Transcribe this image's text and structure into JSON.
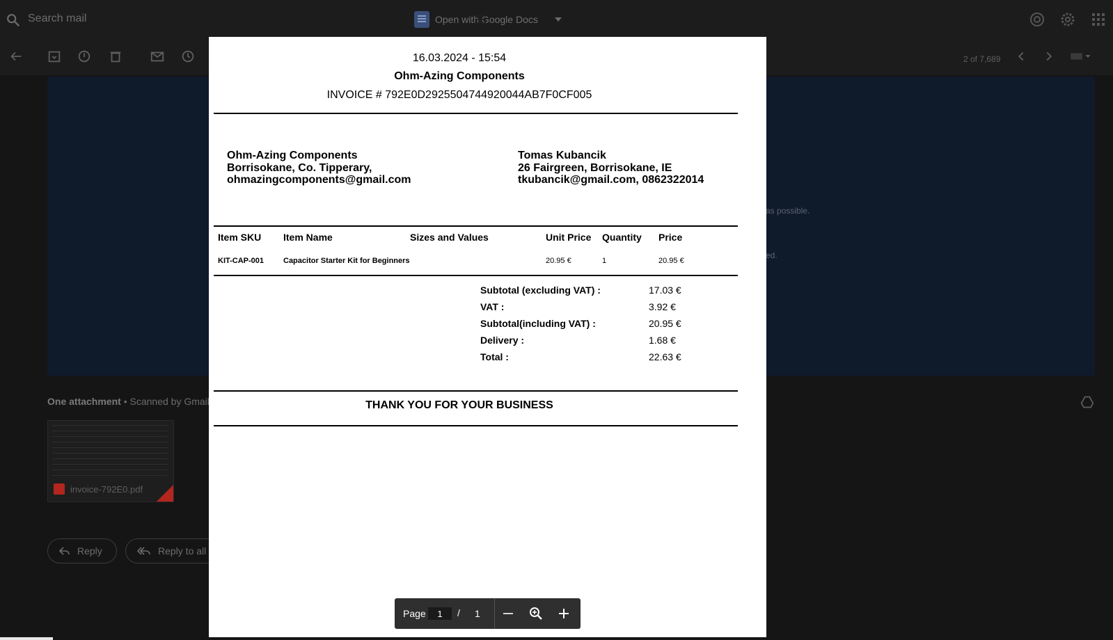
{
  "header": {
    "search_placeholder": "Search mail",
    "open_with_label": "Open with Google Docs"
  },
  "toolbar": {
    "counter": "2 of 7,689"
  },
  "email": {
    "snippet_1": "as possible.",
    "snippet_2": "ed."
  },
  "attachments": {
    "header_label": "One attachment",
    "scanned_label": "• Scanned by Gmail",
    "file_name": "invoice-792E0.pdf"
  },
  "reply": {
    "reply_label": "Reply",
    "reply_all_label": "Reply to all"
  },
  "invoice": {
    "date": "16.03.2024 - 15:54",
    "company": "Ohm-Azing Components",
    "invoice_number": "INVOICE # 792E0D2925504744920044AB7F0CF005",
    "seller": {
      "name": "Ohm-Azing Components",
      "address": "Borrisokane, Co. Tipperary,",
      "email": "ohmazingcomponents@gmail.com"
    },
    "buyer": {
      "name": "Tomas Kubancik",
      "address": "26 Fairgreen, Borrisokane, IE",
      "contact": "tkubancik@gmail.com, 0862322014"
    },
    "columns": [
      "Item SKU",
      "Item Name",
      "Sizes and Values",
      "Unit Price",
      "Quantity",
      "Price"
    ],
    "rows": [
      {
        "sku": "KIT-CAP-001",
        "name": "Capacitor Starter Kit for Beginners",
        "sizes": "",
        "unit_price": "20.95 €",
        "quantity": "1",
        "price": "20.95 €"
      }
    ],
    "totals": [
      {
        "label": "Subtotal (excluding VAT) :",
        "value": "17.03 €"
      },
      {
        "label": "VAT :",
        "value": "3.92 €"
      },
      {
        "label": "Subtotal(including VAT) :",
        "value": "20.95 €"
      },
      {
        "label": "Delivery :",
        "value": "1.68 €"
      },
      {
        "label": "Total :",
        "value": "22.63 €"
      }
    ],
    "thanks": "THANK YOU FOR YOUR BUSINESS"
  },
  "pdf_toolbar": {
    "page_label": "Page",
    "current_page": "1",
    "separator": "/",
    "total_pages": "1"
  },
  "icons": {
    "search": "search-icon",
    "settings": "gear-icon",
    "apps": "apps-grid-icon",
    "zoom": "zoom-icon"
  }
}
